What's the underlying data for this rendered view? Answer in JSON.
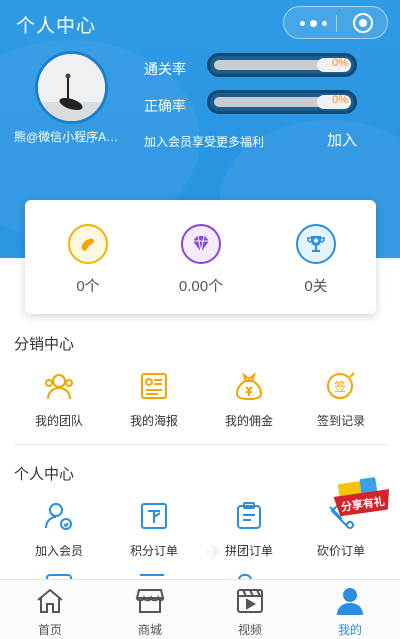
{
  "header": {
    "title": "个人中心"
  },
  "profile": {
    "username": "熊@微信小程序A…",
    "stats": [
      {
        "label": "通关率",
        "value": "0%",
        "progress": 0
      },
      {
        "label": "正确率",
        "value": "0%",
        "progress": 0
      }
    ],
    "vip_tip": "加入会员享受更多福利",
    "vip_join": "加入"
  },
  "summary": [
    {
      "icon": "bean-icon",
      "value": "0个",
      "color": "#f5b400"
    },
    {
      "icon": "diamond-icon",
      "value": "0.00个",
      "color": "#8e44d8"
    },
    {
      "icon": "trophy-icon",
      "value": "0关",
      "color": "#2a8fe0"
    }
  ],
  "distribution": {
    "title": "分销中心",
    "items": [
      {
        "label": "我的团队",
        "icon": "team-icon"
      },
      {
        "label": "我的海报",
        "icon": "poster-icon"
      },
      {
        "label": "我的佣金",
        "icon": "money-bag-icon"
      },
      {
        "label": "签到记录",
        "icon": "sign-in-icon"
      }
    ]
  },
  "personal": {
    "title": "个人中心",
    "items": [
      {
        "label": "加入会员",
        "icon": "member-icon"
      },
      {
        "label": "积分订单",
        "icon": "points-order-icon"
      },
      {
        "label": "拼团订单",
        "icon": "group-order-icon"
      },
      {
        "label": "砍价订单",
        "icon": "bargain-order-icon"
      }
    ],
    "badge": "分享有礼"
  },
  "tabbar": [
    {
      "label": "首页",
      "icon": "home-icon",
      "active": false
    },
    {
      "label": "商城",
      "icon": "shop-icon",
      "active": false
    },
    {
      "label": "视频",
      "icon": "video-icon",
      "active": false
    },
    {
      "label": "我的",
      "icon": "user-icon",
      "active": true
    }
  ],
  "colors": {
    "primary": "#2a95e2",
    "accent": "#f5a300",
    "tab_active": "#2a8fe0"
  }
}
